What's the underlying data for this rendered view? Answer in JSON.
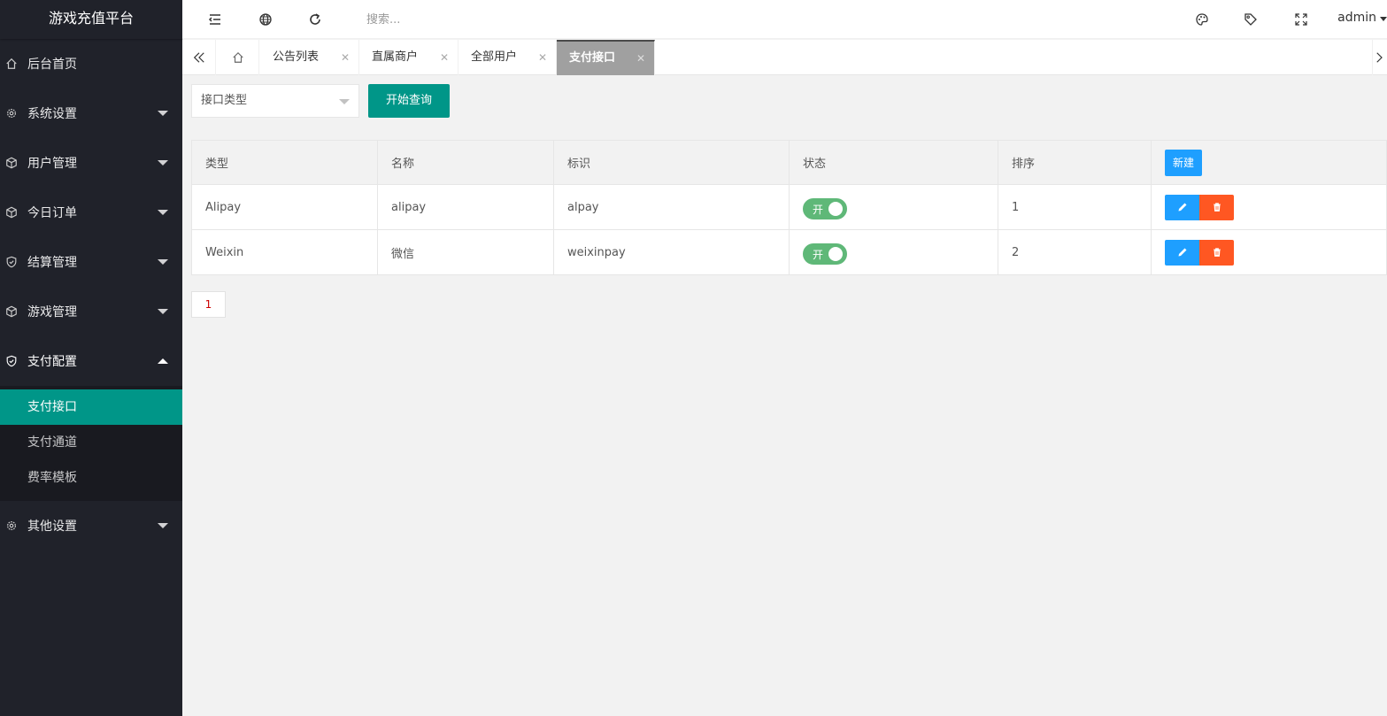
{
  "app": {
    "title": "游戏充值平台"
  },
  "sidebar": {
    "items": [
      {
        "label": "后台首页",
        "icon": "home-icon"
      },
      {
        "label": "系统设置",
        "icon": "gear-icon"
      },
      {
        "label": "用户管理",
        "icon": "cube-icon"
      },
      {
        "label": "今日订单",
        "icon": "cube-icon"
      },
      {
        "label": "结算管理",
        "icon": "shield-check-icon"
      },
      {
        "label": "游戏管理",
        "icon": "cube-icon"
      },
      {
        "label": "支付配置",
        "icon": "shield-check-icon"
      },
      {
        "label": "其他设置",
        "icon": "gear-icon"
      }
    ],
    "sub_items": [
      {
        "label": "支付接口",
        "active": true
      },
      {
        "label": "支付通道"
      },
      {
        "label": "费率模板"
      }
    ]
  },
  "header": {
    "search_placeholder": "搜索...",
    "user": "admin"
  },
  "tabs": [
    {
      "label": "公告列表"
    },
    {
      "label": "直属商户"
    },
    {
      "label": "全部用户"
    },
    {
      "label": "支付接口",
      "active": true
    }
  ],
  "toolbar": {
    "select_placeholder": "接口类型",
    "query_label": "开始查询"
  },
  "table": {
    "columns": [
      "类型",
      "名称",
      "标识",
      "状态",
      "排序"
    ],
    "new_label": "新建",
    "rows": [
      {
        "type": "Alipay",
        "name": "alipay",
        "code": "alpay",
        "status": "开",
        "sort": "1"
      },
      {
        "type": "Weixin",
        "name": "微信",
        "code": "weixinpay",
        "status": "开",
        "sort": "2"
      }
    ]
  },
  "pagination": {
    "current": "1"
  },
  "colors": {
    "accent": "#009688",
    "sidebar_bg": "#20222a",
    "primary_blue": "#1e9fff",
    "danger": "#ff5722",
    "switch_on": "#5fb878"
  }
}
